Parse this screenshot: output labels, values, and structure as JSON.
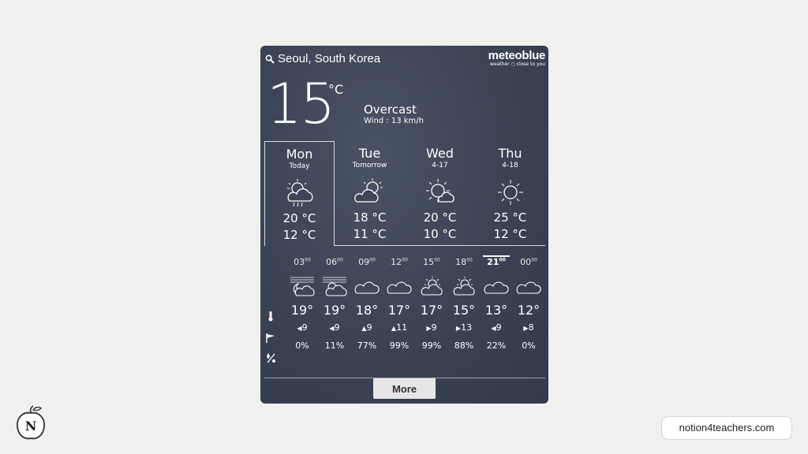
{
  "widget": {
    "location": "Seoul, South Korea",
    "brand": "meteoblue",
    "brand_tagline": "weather ○ close to you",
    "current": {
      "temp": "15",
      "unit": "°C",
      "condition": "Overcast",
      "wind": "Wind : 13 km/h"
    },
    "days": [
      {
        "name": "Mon",
        "sub": "Today",
        "icon": "sun-cloud-rain-icon",
        "high": "20 °C",
        "low": "12 °C"
      },
      {
        "name": "Tue",
        "sub": "Tomorrow",
        "icon": "sun-cloud-icon",
        "high": "18 °C",
        "low": "11 °C"
      },
      {
        "name": "Wed",
        "sub": "4-17",
        "icon": "sun-small-cloud-icon",
        "high": "20 °C",
        "low": "10 °C"
      },
      {
        "name": "Thu",
        "sub": "4-18",
        "icon": "sun-icon",
        "high": "25 °C",
        "low": "12 °C"
      }
    ],
    "hours": [
      {
        "h": "03",
        "icon": "night-cloud-rain-icon",
        "temp": "19°",
        "wind_dir": "◀",
        "wind": "9",
        "rain": "0%"
      },
      {
        "h": "06",
        "icon": "sun-cloud-rain-icon",
        "temp": "19°",
        "wind_dir": "◀",
        "wind": "9",
        "rain": "11%"
      },
      {
        "h": "09",
        "icon": "cloud-icon",
        "temp": "18°",
        "wind_dir": "▲",
        "wind": "9",
        "rain": "77%"
      },
      {
        "h": "12",
        "icon": "cloud-icon",
        "temp": "17°",
        "wind_dir": "▲",
        "wind": "11",
        "rain": "99%"
      },
      {
        "h": "15",
        "icon": "sun-cloud-icon",
        "temp": "17°",
        "wind_dir": "▶",
        "wind": "9",
        "rain": "99%"
      },
      {
        "h": "18",
        "icon": "sun-cloud-icon",
        "temp": "15°",
        "wind_dir": "▶",
        "wind": "13",
        "rain": "88%"
      },
      {
        "h": "21",
        "icon": "cloud-icon",
        "temp": "13°",
        "wind_dir": "◀",
        "wind": "9",
        "rain": "22%"
      },
      {
        "h": "00",
        "icon": "cloud-icon",
        "temp": "12°",
        "wind_dir": "▶",
        "wind": "8",
        "rain": "0%"
      }
    ],
    "hour_minutes": "00",
    "current_hour_index": 6,
    "more_label": "More"
  },
  "footer": {
    "logo_letter": "N",
    "site": "notion4teachers.com"
  }
}
